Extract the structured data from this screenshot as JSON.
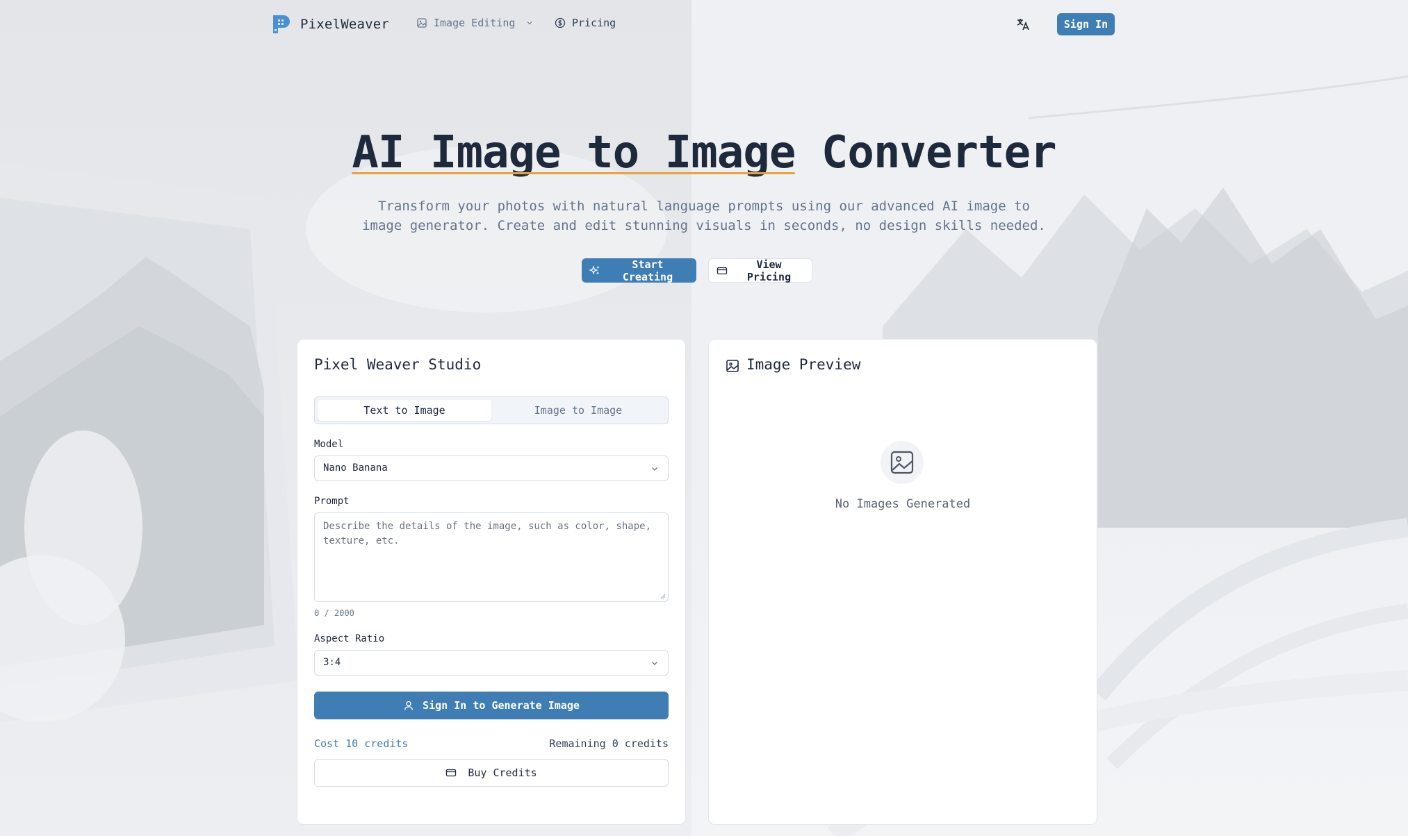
{
  "nav": {
    "brand": "PixelWeaver",
    "links": [
      {
        "label": "Image Editing",
        "icon": "image-edit-icon",
        "has_dropdown": true
      },
      {
        "label": "Pricing",
        "icon": "dollar-circle-icon",
        "has_dropdown": false
      }
    ],
    "sign_in_label": "Sign In"
  },
  "hero": {
    "title_highlight": "AI Image to Image",
    "title_rest": " Converter",
    "subtitle": "Transform your photos with natural language prompts using our advanced AI image to image generator. Create and edit stunning visuals in seconds, no design skills needed.",
    "start_label": "Start Creating",
    "pricing_label": "View Pricing"
  },
  "studio": {
    "title": "Pixel Weaver Studio",
    "tabs": [
      {
        "label": "Text to Image",
        "active": true
      },
      {
        "label": "Image to Image",
        "active": false
      }
    ],
    "model_label": "Model",
    "model_value": "Nano Banana",
    "prompt_label": "Prompt",
    "prompt_placeholder": "Describe the details of the image, such as color, shape, texture, etc.",
    "prompt_counter": "0 / 2000",
    "aspect_label": "Aspect Ratio",
    "aspect_value": "3:4",
    "generate_label": "Sign In to Generate Image",
    "cost_text": "Cost 10 credits",
    "remaining_text": "Remaining 0 credits",
    "buy_label": "Buy Credits"
  },
  "preview": {
    "title": "Image Preview",
    "empty_text": "No Images Generated"
  },
  "colors": {
    "accent": "#3f7db5",
    "underline": "#e6a23c",
    "text": "#1e293b",
    "muted": "#64748b"
  }
}
